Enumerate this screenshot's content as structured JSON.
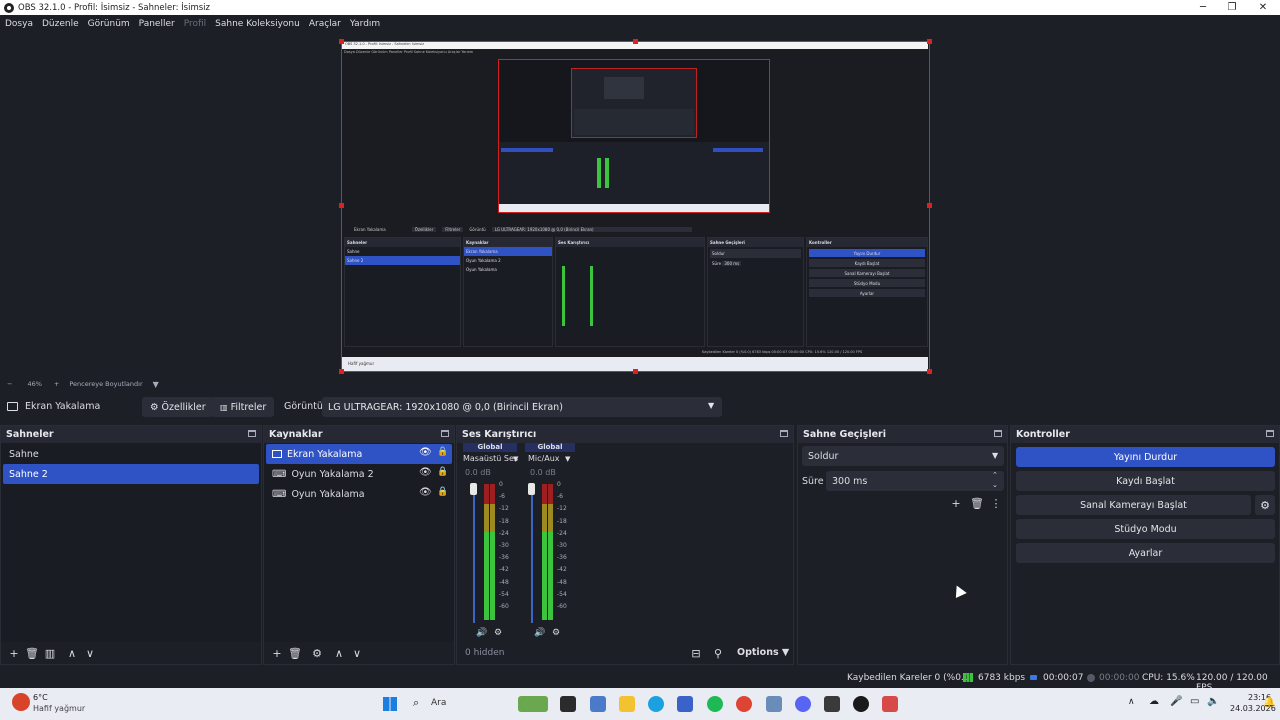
{
  "window": {
    "title": "OBS 32.1.0 - Profil: İsimsiz - Sahneler: İsimsiz",
    "minimize_glyph": "─",
    "maximize_glyph": "❐",
    "close_glyph": "✕"
  },
  "menu": {
    "items": [
      "Dosya",
      "Düzenle",
      "Görünüm",
      "Paneller",
      "Profil",
      "Sahne Koleksiyonu",
      "Araçlar",
      "Yardım"
    ]
  },
  "zoombar": {
    "minus": "−",
    "zoom": "46%",
    "plus": "+",
    "mode": "Pencereye Boyutlandır"
  },
  "source_toolbar": {
    "source_name": "Ekran Yakalama",
    "properties_label": "Özellikler",
    "filters_label": "Filtreler",
    "display_label": "Görüntü",
    "display_value": "LG ULTRAGEAR: 1920x1080 @ 0,0 (Birincil Ekran)"
  },
  "scenes": {
    "title": "Sahneler",
    "items": [
      {
        "label": "Sahne"
      },
      {
        "label": "Sahne 2"
      }
    ]
  },
  "sources": {
    "title": "Kaynaklar",
    "items": [
      {
        "label": "Ekran Yakalama"
      },
      {
        "label": "Oyun Yakalama 2"
      },
      {
        "label": "Oyun Yakalama"
      }
    ]
  },
  "mixer": {
    "title": "Ses Karıştırıcı",
    "channels": [
      {
        "badge": "Global",
        "name": "Masaüstü Ses",
        "db": "0.0 dB"
      },
      {
        "badge": "Global",
        "name": "Mic/Aux",
        "db": "0.0 dB"
      }
    ],
    "scale": [
      "0",
      "-6",
      "-12",
      "-18",
      "-24",
      "-30",
      "-36",
      "-42",
      "-48",
      "-54",
      "-60"
    ],
    "hidden_label": "0 hidden",
    "options_label": "Options"
  },
  "transitions": {
    "title": "Sahne Geçişleri",
    "selected": "Soldur",
    "duration_label": "Süre",
    "duration_value": "300 ms"
  },
  "controls": {
    "title": "Kontroller",
    "stop_stream": "Yayını Durdur",
    "start_record": "Kaydı Başlat",
    "start_virtualcam": "Sanal Kamerayı Başlat",
    "studio_mode": "Stüdyo Modu",
    "settings": "Ayarlar"
  },
  "status": {
    "dropped_frames": "Kaybedilen Kareler 0 (%0.0)",
    "bitrate": "6783 kbps",
    "stream_time": "00:00:07",
    "record_time": "00:00:00",
    "cpu": "CPU: 15.6%",
    "fps": "120.00 / 120.00 FPS"
  },
  "taskbar": {
    "weather_temp": "6°C",
    "weather_desc": "Hafif yağmur",
    "search_placeholder": "Ara",
    "time": "23:16",
    "date": "24.03.2026"
  },
  "preview_inner": {
    "title": "OBS 32.1.0 - Profil: İsimsiz - Sahneler: İsimsiz",
    "menu": "Dosya  Düzenle  Görünüm  Paneller  Profil  Sahne Koleksiyonu  Araçlar  Yardım",
    "source": "Ekran Yakalama",
    "props": "Özellikler",
    "filters": "Filtreler",
    "display": "Görüntü",
    "display_value": "LG ULTRAGEAR: 1920x1080 @ 0,0 (Birincil Ekran)",
    "scenes_title": "Sahneler",
    "scene1": "Sahne",
    "scene2": "Sahne 2",
    "sources_title": "Kaynaklar",
    "src1": "Ekran Yakalama",
    "src2": "Oyun Yakalama 2",
    "src3": "Oyun Yakalama",
    "mixer_title": "Ses Karıştırıcı",
    "trans_title": "Sahne Geçişleri",
    "trans_sel": "Soldur",
    "trans_dur_label": "Süre",
    "trans_dur": "300 ms",
    "ctrl_title": "Kontroller",
    "ctrl1": "Yayını Durdur",
    "ctrl2": "Kaydı Başlat",
    "ctrl3": "Sanal Kamerayı Başlat",
    "ctrl4": "Stüdyo Modu",
    "ctrl5": "Ayarlar",
    "status": "Kaybedilen Kareler 0 (%0.0)   6783 kbps   00:00:07   00:00:00   CPU: 15.6%   120.00 / 120.00 FPS",
    "weather": "Hafif yağmur"
  },
  "colors": {
    "accent": "#2f52c4",
    "preview_border": "#e02020",
    "meter_green": "#3cc43c",
    "meter_yellow": "#c8b020",
    "meter_red": "#c82020"
  }
}
